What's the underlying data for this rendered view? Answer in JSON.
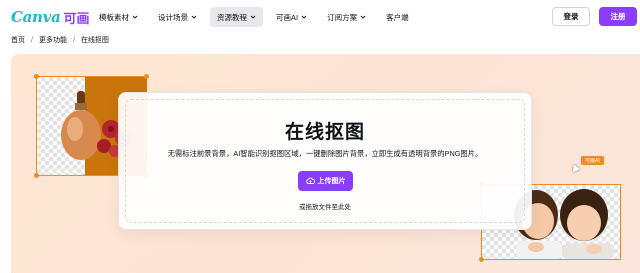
{
  "header": {
    "logo_text": "Canva",
    "logo_cn": "可画",
    "nav": [
      {
        "label": "模板素材",
        "active": false
      },
      {
        "label": "设计场景",
        "active": false
      },
      {
        "label": "资源教程",
        "active": true
      },
      {
        "label": "可画AI",
        "active": false
      },
      {
        "label": "订阅方案",
        "active": false
      },
      {
        "label": "客户端",
        "active": false
      }
    ],
    "login_label": "登录",
    "signup_label": "注册"
  },
  "breadcrumb": {
    "items": [
      "首页",
      "更多功能",
      "在线抠图"
    ],
    "separator": "/"
  },
  "hero": {
    "title": "在线抠图",
    "subtitle": "无需标注前景背景，AI智能识别抠图区域，一键删除图片背景，立即生成有透明背景的PNG图片。",
    "upload_label": "上传图片",
    "drop_hint": "或拖放文件至此处",
    "tag_label": "可画AI"
  },
  "colors": {
    "brand": "#8b3dff",
    "accent_orange": "#f08a24",
    "logo_cyan": "#1fb5d3"
  },
  "icons": {
    "nav_caret": "chevron-down-icon",
    "upload": "cloud-upload-icon"
  }
}
